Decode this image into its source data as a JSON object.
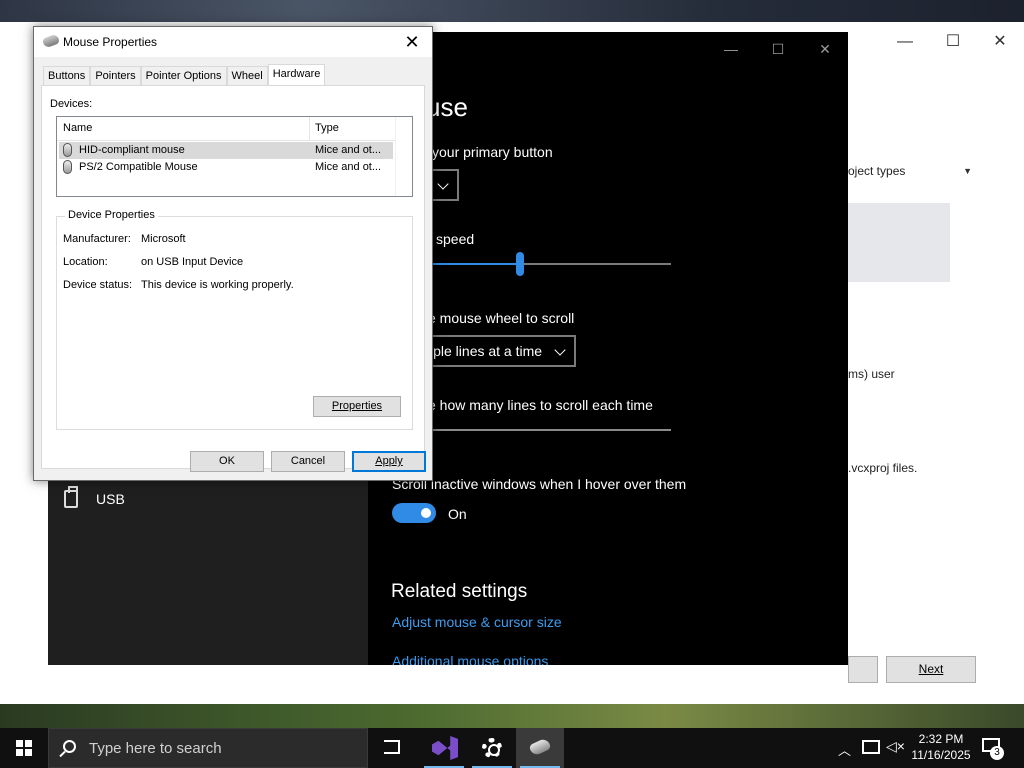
{
  "wizard": {
    "combo_text": "oject types",
    "text_user": "ms) user",
    "text_files": ".vcxproj files.",
    "next_label": "Next",
    "controls": {
      "minimize": "—",
      "maximize": "☐",
      "close": "✕"
    }
  },
  "settings": {
    "title": "use",
    "primary_button_label": "your primary button",
    "speed_label": "speed",
    "wheel_label": "e mouse wheel to scroll",
    "wheel_value": "iple lines at a time",
    "lines_label": "e how many lines to scroll each time",
    "inactive_label": "Scroll inactive windows when I hover over them",
    "toggle_state": "On",
    "related_heading": "Related settings",
    "link_adjust": "Adjust mouse & cursor size",
    "link_additional": "Additional mouse options",
    "nav_usb": "USB",
    "speed_fraction": 0.38,
    "controls": {
      "minimize": "—",
      "maximize": "☐",
      "close": "✕"
    }
  },
  "dialog": {
    "title": "Mouse Properties",
    "tabs": [
      "Buttons",
      "Pointers",
      "Pointer Options",
      "Wheel",
      "Hardware"
    ],
    "active_tab": "Hardware",
    "devices_label": "Devices:",
    "col_name": "Name",
    "col_type": "Type",
    "devices": [
      {
        "name": "HID-compliant mouse",
        "type": "Mice and ot...",
        "selected": true
      },
      {
        "name": "PS/2 Compatible Mouse",
        "type": "Mice and ot...",
        "selected": false
      }
    ],
    "group_title": "Device Properties",
    "manufacturer_label": "Manufacturer:",
    "manufacturer_value": "Microsoft",
    "location_label": "Location:",
    "location_value": "on USB Input Device",
    "status_label": "Device status:",
    "status_value": "This device is working properly.",
    "properties_btn": "Properties",
    "ok_btn": "OK",
    "cancel_btn": "Cancel",
    "apply_btn": "Apply",
    "close_glyph": "✕"
  },
  "taskbar": {
    "search_placeholder": "Type here to search",
    "time": "2:32 PM",
    "date": "11/16/2025",
    "notification_count": "3",
    "accent": "#76b9ed"
  }
}
